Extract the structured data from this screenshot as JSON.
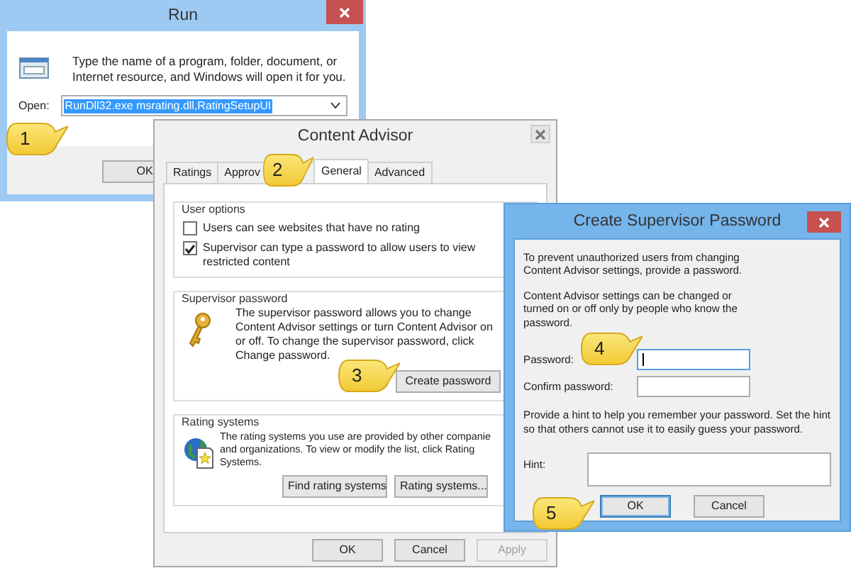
{
  "run_window": {
    "title": "Run",
    "description": "Type the name of a program, folder, document, or Internet resource, and Windows will open it for you.",
    "open_label": "Open:",
    "command": "RunDll32.exe msrating.dll,RatingSetupUI",
    "buttons": [
      "OK"
    ]
  },
  "content_advisor": {
    "title": "Content Advisor",
    "tabs": [
      {
        "label": "Ratings",
        "selected": false
      },
      {
        "label": "Approv",
        "selected": false
      },
      {
        "label": "General",
        "selected": true
      },
      {
        "label": "Advanced",
        "selected": false
      }
    ],
    "user_options": {
      "title": "User options",
      "options": [
        {
          "label": "Users can see websites that have no rating",
          "checked": false
        },
        {
          "label": "Supervisor can type a password to allow users to view restricted content",
          "checked": true
        }
      ]
    },
    "supervisor_password": {
      "title": "Supervisor password",
      "text": "The supervisor password allows you to change Content Advisor settings or turn Content Advisor on or off. To change the supervisor password, click Change password.",
      "button": "Create password"
    },
    "rating_systems": {
      "title": "Rating systems",
      "lines": [
        "The rating systems you use are provided by other companie",
        "and organizations. To view or modify the list, click Rating",
        "Systems."
      ],
      "buttons": [
        "Find rating systems",
        "Rating systems..."
      ]
    },
    "buttons": [
      {
        "label": "OK",
        "disabled": false
      },
      {
        "label": "Cancel",
        "disabled": false
      },
      {
        "label": "Apply",
        "disabled": true
      }
    ]
  },
  "create_password": {
    "title": "Create Supervisor Password",
    "intro": "To prevent unauthorized users from changing Content Advisor settings, provide a password.",
    "info": "Content Advisor settings can be changed or turned on or off only by people who know the password.",
    "fields": [
      {
        "label": "Password:",
        "focused": true
      },
      {
        "label": "Confirm password:",
        "focused": false
      }
    ],
    "hint_text": "Provide a hint to help you remember your password. Set the hint so that others cannot use it to easily guess your password.",
    "hint_label": "Hint:",
    "buttons": [
      {
        "label": "OK",
        "default": true
      },
      {
        "label": "Cancel",
        "default": false
      }
    ]
  },
  "callouts": [
    {
      "label": "1"
    },
    {
      "label": "2"
    },
    {
      "label": "3"
    },
    {
      "label": "4"
    },
    {
      "label": "5"
    }
  ]
}
